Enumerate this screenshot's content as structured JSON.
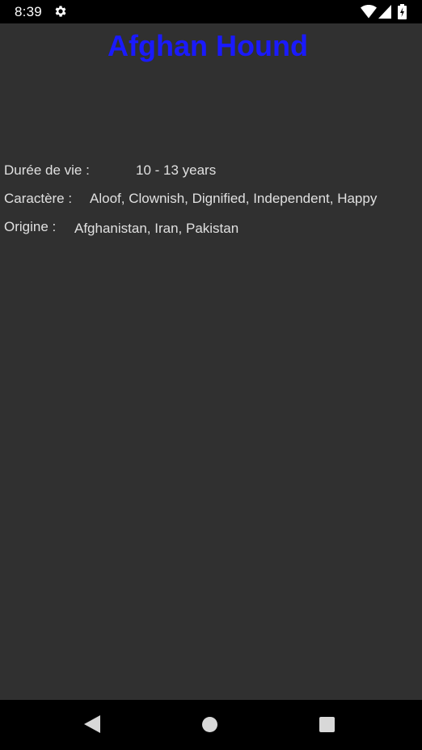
{
  "status_bar": {
    "time": "8:39",
    "icons": [
      "gear-icon",
      "wifi-icon",
      "signal-icon",
      "battery-icon"
    ]
  },
  "title": "Afghan Hound",
  "details": {
    "lifespan_label": "Durée de vie  :",
    "lifespan_value": "10 - 13 years",
    "temperament_label": "Caractère :",
    "temperament_value": "Aloof, Clownish, Dignified, Independent, Happy",
    "origin_label": "Origine :",
    "origin_value": "Afghanistan, Iran, Pakistan"
  },
  "navigation": {
    "icons": [
      "back-icon",
      "home-icon",
      "recent-apps-icon"
    ]
  },
  "colors": {
    "background": "#303030",
    "title": "#1a1aff",
    "text": "#e0e0e0",
    "bars": "#000000"
  }
}
